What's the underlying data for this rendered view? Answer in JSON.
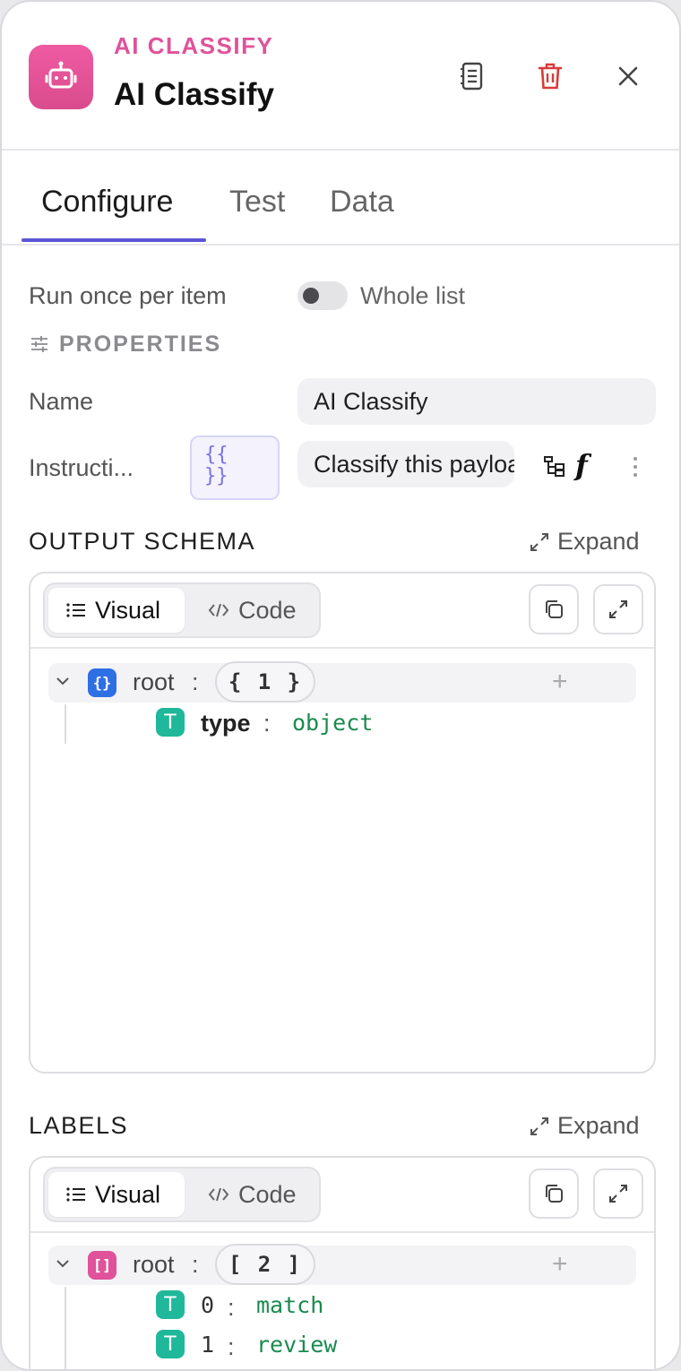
{
  "header": {
    "node_type": "AI CLASSIFY",
    "title": "AI Classify",
    "icons": [
      "robot-icon",
      "notes-icon",
      "trash-icon",
      "close-icon"
    ],
    "accent": "#e0529a",
    "danger": "#d93a3a"
  },
  "tabs": [
    {
      "label": "Configure",
      "active": true
    },
    {
      "label": "Test",
      "active": false
    },
    {
      "label": "Data",
      "active": false
    }
  ],
  "tab_accent": "#5a55d6",
  "run_mode": {
    "label": "Run once per item",
    "toggle_label": "Whole list",
    "toggle_on": false
  },
  "properties": {
    "section_title": "PROPERTIES",
    "name_label": "Name",
    "name_value": "AI Classify",
    "instructions_label": "Instructi...",
    "instructions_value": "Classify this payload",
    "braces_top": "{{",
    "braces_bottom": "}}",
    "fx_label": "f"
  },
  "output_schema": {
    "title": "OUTPUT SCHEMA",
    "expand_label": "Expand",
    "view_visual": "Visual",
    "view_code": "Code",
    "root_label": "root",
    "root_type": "object",
    "root_count": "{ 1 }",
    "children": [
      {
        "key": "type",
        "value": "object"
      }
    ]
  },
  "labels": {
    "title": "LABELS",
    "expand_label": "Expand",
    "view_visual": "Visual",
    "view_code": "Code",
    "root_label": "root",
    "root_type": "array",
    "root_count": "[ 2 ]",
    "children": [
      {
        "key": "0",
        "value": "match"
      },
      {
        "key": "1",
        "value": "review"
      }
    ]
  }
}
